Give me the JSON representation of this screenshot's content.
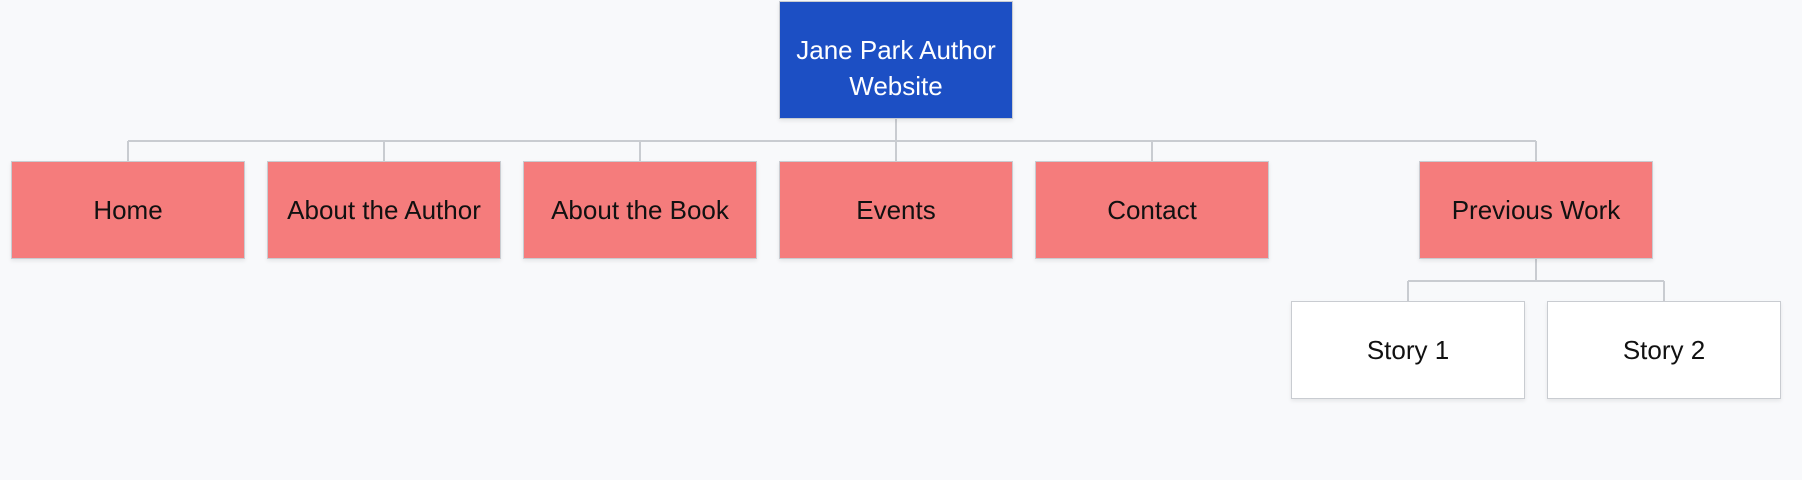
{
  "diagram": {
    "root": {
      "label": "Jane Park Author Website"
    },
    "sections": [
      {
        "label": "Home"
      },
      {
        "label": "About the Author"
      },
      {
        "label": "About the Book"
      },
      {
        "label": "Events"
      },
      {
        "label": "Contact"
      },
      {
        "label": "Previous Work"
      }
    ],
    "previous_work_children": [
      {
        "label": "Story 1"
      },
      {
        "label": "Story 2"
      }
    ],
    "colors": {
      "background": "#f8f9fb",
      "root_fill": "#1c4fc4",
      "section_fill": "#f57c7c",
      "leaf_fill": "#ffffff",
      "connector": "#c9ccd1"
    }
  }
}
